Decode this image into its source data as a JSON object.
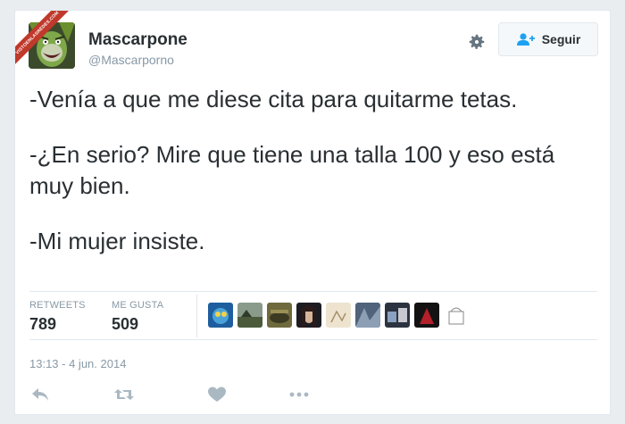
{
  "watermark": {
    "text": "VISTOENLASREDES.COM"
  },
  "user": {
    "name": "Mascarpone",
    "handle": "@Mascarporno"
  },
  "follow_button": {
    "label": "Seguir"
  },
  "tweet": {
    "paragraphs": [
      "-Venía a que me diese cita para quitarme tetas.",
      "-¿En serio? Mire que tiene una talla 100 y eso está muy bien.",
      "-Mi mujer insiste."
    ]
  },
  "stats": {
    "retweets": {
      "label": "RETWEETS",
      "value": "789"
    },
    "likes": {
      "label": "ME GUSTA",
      "value": "509"
    }
  },
  "likers": {
    "count_shown": 9
  },
  "timestamp": "13:13 - 4 jun. 2014",
  "actions": {
    "icons": [
      "reply-icon",
      "retweet-icon",
      "heart-icon",
      "more-icon"
    ]
  },
  "colors": {
    "text": "#292f33",
    "muted": "#8899a6",
    "accent": "#1da1f2",
    "border": "#e1e8ed",
    "watermark": "#c0392b"
  }
}
